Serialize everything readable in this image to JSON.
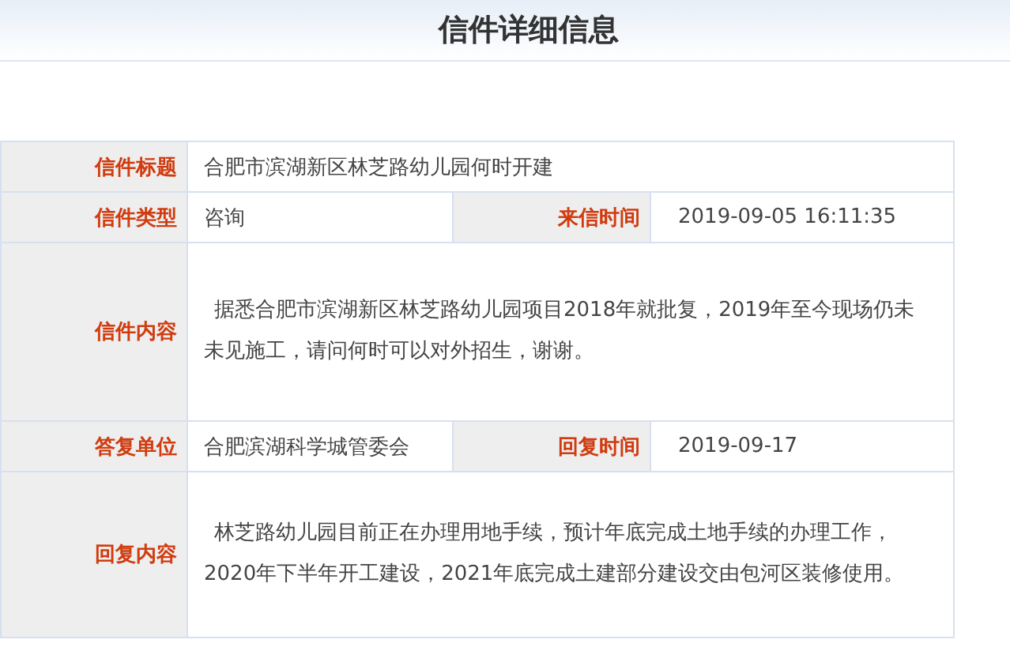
{
  "header": {
    "title": "信件详细信息"
  },
  "rows": [
    {
      "kind": "single",
      "label": "信件标题",
      "value": "合肥市滨湖新区林芝路幼儿园何时开建"
    },
    {
      "kind": "pair",
      "label": "信件类型",
      "value": "咨询",
      "label_2": "来信时间",
      "value_2": "2019-09-05 16:11:35"
    },
    {
      "kind": "paragraph",
      "label": "信件内容",
      "value": "据悉合肥市滨湖新区林芝路幼儿园项目2018年就批复，2019年至今现场仍未未见施工，请问何时可以对外招生，谢谢。"
    },
    {
      "kind": "pair",
      "label": "答复单位",
      "value": "合肥滨湖科学城管委会",
      "label_2": "回复时间",
      "value_2": "2019-09-17"
    },
    {
      "kind": "paragraph",
      "label": "回复内容",
      "value": "林芝路幼儿园目前正在办理用地手续，预计年底完成土地手续的办理工作，2020年下半年开工建设，2021年底完成土建部分建设交由包河区装修使用。"
    }
  ]
}
